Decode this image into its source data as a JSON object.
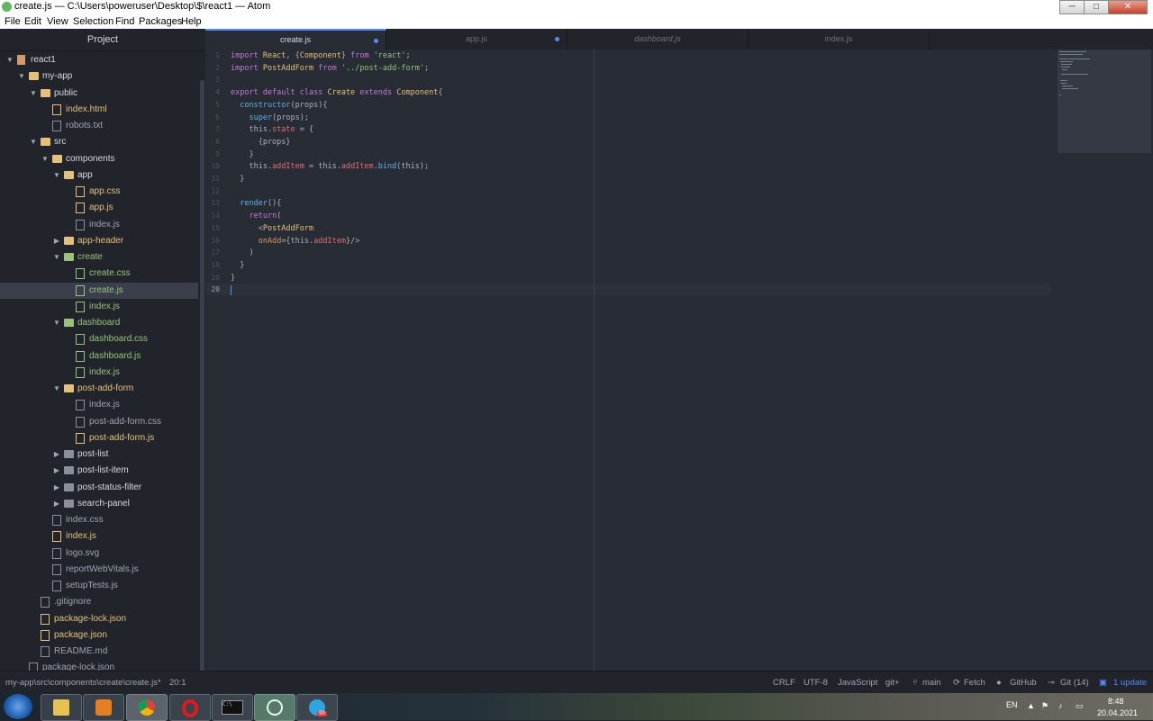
{
  "window": {
    "title": "create.js — C:\\Users\\poweruser\\Desktop\\$\\react1 — Atom",
    "min": "─",
    "max": "□",
    "close": "✕"
  },
  "menu": [
    "File",
    "Edit",
    "View",
    "Selection",
    "Find",
    "Packages",
    "Help"
  ],
  "tree": {
    "header": "Project",
    "items": [
      {
        "label": "react1",
        "depth": 0,
        "kind": "repo",
        "open": true
      },
      {
        "label": "my-app",
        "depth": 1,
        "kind": "folder",
        "open": true
      },
      {
        "label": "public",
        "depth": 2,
        "kind": "folder",
        "open": true
      },
      {
        "label": "index.html",
        "depth": 3,
        "kind": "file",
        "color": "yellow"
      },
      {
        "label": "robots.txt",
        "depth": 3,
        "kind": "file",
        "color": "gray"
      },
      {
        "label": "src",
        "depth": 2,
        "kind": "folder",
        "open": true
      },
      {
        "label": "components",
        "depth": 3,
        "kind": "folder",
        "open": true
      },
      {
        "label": "app",
        "depth": 4,
        "kind": "folder",
        "open": true
      },
      {
        "label": "app.css",
        "depth": 5,
        "kind": "file",
        "color": "yellow"
      },
      {
        "label": "app.js",
        "depth": 5,
        "kind": "file",
        "color": "yellow"
      },
      {
        "label": "index.js",
        "depth": 5,
        "kind": "file",
        "color": "gray"
      },
      {
        "label": "app-header",
        "depth": 4,
        "kind": "folder",
        "open": false,
        "color": "yellow"
      },
      {
        "label": "create",
        "depth": 4,
        "kind": "folder",
        "open": true,
        "color": "green"
      },
      {
        "label": "create.css",
        "depth": 5,
        "kind": "file",
        "color": "green"
      },
      {
        "label": "create.js",
        "depth": 5,
        "kind": "file",
        "color": "green",
        "selected": true
      },
      {
        "label": "index.js",
        "depth": 5,
        "kind": "file",
        "color": "green"
      },
      {
        "label": "dashboard",
        "depth": 4,
        "kind": "folder",
        "open": true,
        "color": "green"
      },
      {
        "label": "dashboard.css",
        "depth": 5,
        "kind": "file",
        "color": "green"
      },
      {
        "label": "dashboard.js",
        "depth": 5,
        "kind": "file",
        "color": "green"
      },
      {
        "label": "index.js",
        "depth": 5,
        "kind": "file",
        "color": "green"
      },
      {
        "label": "post-add-form",
        "depth": 4,
        "kind": "folder",
        "open": true,
        "color": "yellow"
      },
      {
        "label": "index.js",
        "depth": 5,
        "kind": "file",
        "color": "gray"
      },
      {
        "label": "post-add-form.css",
        "depth": 5,
        "kind": "file",
        "color": "gray"
      },
      {
        "label": "post-add-form.js",
        "depth": 5,
        "kind": "file",
        "color": "yellow"
      },
      {
        "label": "post-list",
        "depth": 4,
        "kind": "folder",
        "open": false,
        "color": "gray"
      },
      {
        "label": "post-list-item",
        "depth": 4,
        "kind": "folder",
        "open": false,
        "color": "gray"
      },
      {
        "label": "post-status-filter",
        "depth": 4,
        "kind": "folder",
        "open": false,
        "color": "gray"
      },
      {
        "label": "search-panel",
        "depth": 4,
        "kind": "folder",
        "open": false,
        "color": "gray"
      },
      {
        "label": "index.css",
        "depth": 3,
        "kind": "file",
        "color": "gray"
      },
      {
        "label": "index.js",
        "depth": 3,
        "kind": "file",
        "color": "yellow"
      },
      {
        "label": "logo.svg",
        "depth": 3,
        "kind": "file",
        "color": "gray"
      },
      {
        "label": "reportWebVitals.js",
        "depth": 3,
        "kind": "file",
        "color": "gray"
      },
      {
        "label": "setupTests.js",
        "depth": 3,
        "kind": "file",
        "color": "gray"
      },
      {
        "label": ".gitignore",
        "depth": 2,
        "kind": "file",
        "color": "gray"
      },
      {
        "label": "package-lock.json",
        "depth": 2,
        "kind": "file",
        "color": "yellow"
      },
      {
        "label": "package.json",
        "depth": 2,
        "kind": "file",
        "color": "yellow"
      },
      {
        "label": "README.md",
        "depth": 2,
        "kind": "file",
        "color": "gray"
      },
      {
        "label": "package-lock.json",
        "depth": 1,
        "kind": "file",
        "color": "gray"
      }
    ]
  },
  "tabs": [
    {
      "label": "create.js",
      "active": true,
      "modified": true
    },
    {
      "label": "app.js",
      "active": false,
      "modified": true
    },
    {
      "label": "dashboard.js",
      "active": false,
      "modified": false,
      "italic": true
    },
    {
      "label": "index.js",
      "active": false,
      "modified": false
    }
  ],
  "code_lines": [
    [
      [
        "k",
        "import "
      ],
      [
        "c",
        "React"
      ],
      [
        "p",
        ", {"
      ],
      [
        "c",
        "Component"
      ],
      [
        "p",
        "} "
      ],
      [
        "k",
        "from "
      ],
      [
        "s",
        "'react'"
      ],
      [
        "p",
        ";"
      ]
    ],
    [
      [
        "k",
        "import "
      ],
      [
        "c",
        "PostAddForm "
      ],
      [
        "k",
        "from "
      ],
      [
        "s",
        "'../post-add-form'"
      ],
      [
        "p",
        ";"
      ]
    ],
    [],
    [
      [
        "k",
        "export default class "
      ],
      [
        "c",
        "Create "
      ],
      [
        "k",
        "extends "
      ],
      [
        "c",
        "Component"
      ],
      [
        "p",
        "{"
      ]
    ],
    [
      [
        "p",
        "  "
      ],
      [
        "f",
        "constructor"
      ],
      [
        "p",
        "(props){"
      ]
    ],
    [
      [
        "p",
        "    "
      ],
      [
        "f",
        "super"
      ],
      [
        "p",
        "(props);"
      ]
    ],
    [
      [
        "p",
        "    this."
      ],
      [
        "r",
        "state"
      ],
      [
        "p",
        " = {"
      ]
    ],
    [
      [
        "p",
        "      {props}"
      ]
    ],
    [
      [
        "p",
        "    }"
      ]
    ],
    [
      [
        "p",
        "    this."
      ],
      [
        "r",
        "addItem"
      ],
      [
        "p",
        " = this."
      ],
      [
        "r",
        "addItem"
      ],
      [
        "p",
        "."
      ],
      [
        "f",
        "bind"
      ],
      [
        "p",
        "(this);"
      ]
    ],
    [
      [
        "p",
        "  }"
      ]
    ],
    [],
    [
      [
        "p",
        "  "
      ],
      [
        "f",
        "render"
      ],
      [
        "p",
        "(){"
      ]
    ],
    [
      [
        "p",
        "    "
      ],
      [
        "k",
        "return"
      ],
      [
        "p",
        "("
      ]
    ],
    [
      [
        "p",
        "      <"
      ],
      [
        "c",
        "PostAddForm"
      ]
    ],
    [
      [
        "p",
        "      "
      ],
      [
        "o",
        "onAdd"
      ],
      [
        "p",
        "={this."
      ],
      [
        "r",
        "addItem"
      ],
      [
        "p",
        "}/>"
      ]
    ],
    [
      [
        "p",
        "    )"
      ]
    ],
    [
      [
        "p",
        "  }"
      ]
    ],
    [
      [
        "p",
        "}"
      ]
    ],
    []
  ],
  "status": {
    "path": "my-app\\src\\components\\create\\create.js*",
    "cursor": "20:1",
    "eol": "CRLF",
    "encoding": "UTF-8",
    "grammar": "JavaScript",
    "git_plus": "git+",
    "branch": "main",
    "fetch": "Fetch",
    "github": "GitHub",
    "git": "Git (14)",
    "update": "1 update"
  },
  "taskbar": {
    "lang": "EN",
    "time": "8:48",
    "date": "20.04.2021",
    "telegram_badge": "99",
    "cmd_label": "C:\\",
    "apps": [
      "start-orb",
      "file-explorer",
      "media-player",
      "chrome",
      "opera",
      "command-prompt",
      "atom",
      "telegram"
    ]
  }
}
